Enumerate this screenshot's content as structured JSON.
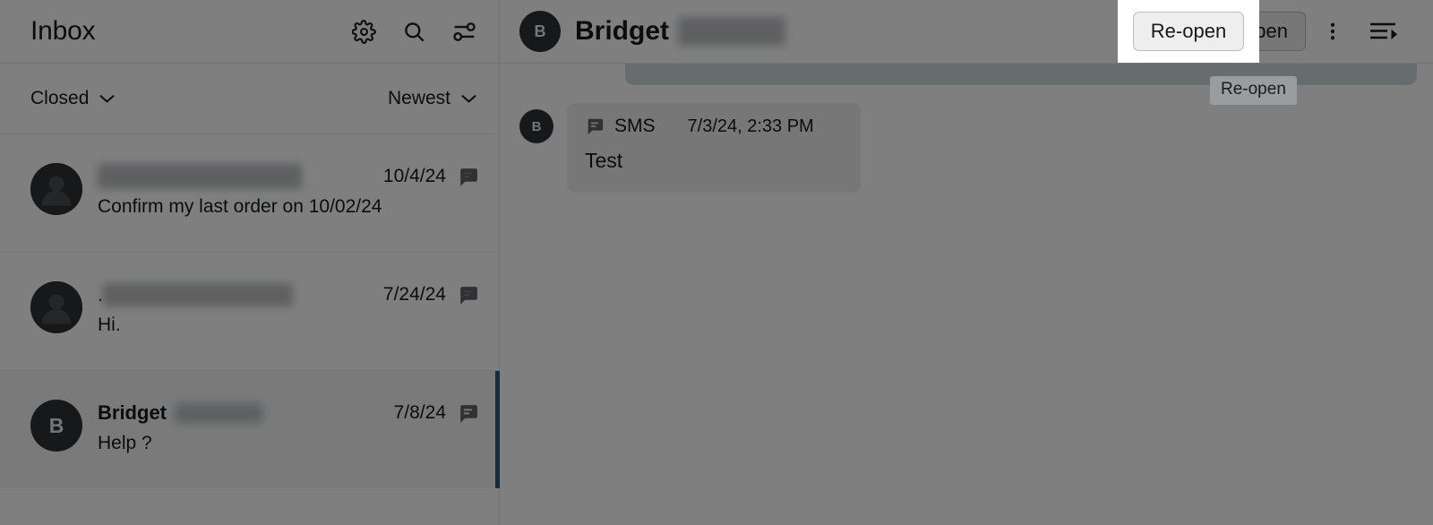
{
  "sidebar": {
    "title": "Inbox",
    "header_icons": [
      {
        "name": "gear-icon",
        "label": "Settings"
      },
      {
        "name": "search-icon",
        "label": "Search"
      },
      {
        "name": "filter-tune-icon",
        "label": "Filters"
      }
    ],
    "filters": {
      "status": "Closed",
      "sort": "Newest",
      "chevron_icon": "chevron-down-icon"
    },
    "conversations": [
      {
        "avatar_type": "person-placeholder",
        "avatar_initial": "",
        "name": "",
        "name_redacted": true,
        "date": "10/4/24",
        "channel_icon": "sms-chat-icon",
        "preview": "Confirm my last order on 10/02/24",
        "selected": false,
        "unread": false
      },
      {
        "avatar_type": "person-placeholder",
        "avatar_initial": "",
        "name": ".",
        "name_redacted": true,
        "date": "7/24/24",
        "channel_icon": "sms-chat-icon",
        "preview": "Hi.",
        "selected": false,
        "unread": false
      },
      {
        "avatar_type": "initial",
        "avatar_initial": "B",
        "name": "Bridget",
        "name_redacted": true,
        "date": "7/8/24",
        "channel_icon": "sms-chat-icon",
        "preview": "Help ?",
        "selected": true,
        "unread": true
      }
    ]
  },
  "thread": {
    "header": {
      "avatar_initial": "B",
      "title": "Bridget",
      "title_redacted": true,
      "reopen_label": "Re-open",
      "kebab_icon": "more-vertical-icon",
      "queue_icon": "queue-list-icon"
    },
    "messages": [
      {
        "direction": "outgoing",
        "clipped": true,
        "text": ""
      },
      {
        "direction": "incoming",
        "avatar_initial": "B",
        "channel_icon": "sms-chat-icon",
        "channel": "SMS",
        "timestamp": "7/3/24, 2:33 PM",
        "text": "Test"
      }
    ]
  },
  "overlay": {
    "tooltip_text": "Re-open",
    "spotlight_target": "reopen-button",
    "scrim_color": "#000000",
    "scrim_opacity": "0.5"
  },
  "colors": {
    "selected_indicator": "#2b5a86",
    "avatar_bg": "#2f3133",
    "incoming_bubble": "#efefef",
    "outgoing_bubble": "#cfd8dd",
    "button_bg": "#eeeeee",
    "tooltip_bg": "#9a9da0"
  }
}
